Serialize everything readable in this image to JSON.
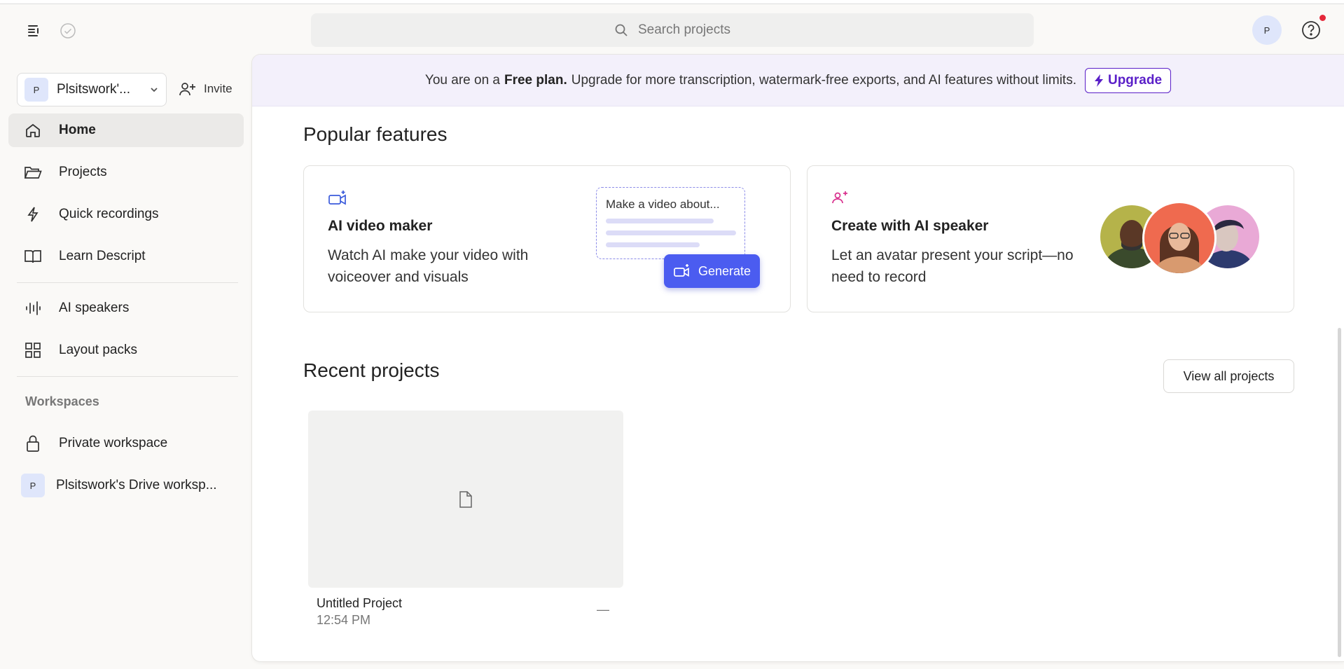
{
  "search": {
    "placeholder": "Search projects"
  },
  "user": {
    "initial": "P"
  },
  "sidebar": {
    "team_name": "Plsitswork'...",
    "team_initial": "P",
    "invite_label": "Invite",
    "items": [
      {
        "label": "Home",
        "icon": "home-icon",
        "active": true
      },
      {
        "label": "Projects",
        "icon": "folder-icon"
      },
      {
        "label": "Quick recordings",
        "icon": "bolt-icon"
      },
      {
        "label": "Learn Descript",
        "icon": "book-icon"
      },
      {
        "label": "AI speakers",
        "icon": "waveform-icon"
      },
      {
        "label": "Layout packs",
        "icon": "grid-icon"
      }
    ],
    "workspaces_title": "Workspaces",
    "workspaces": [
      {
        "label": "Private workspace",
        "icon": "lock-icon"
      },
      {
        "label": "Plsitswork's Drive worksp...",
        "initial": "P"
      }
    ]
  },
  "banner": {
    "prefix": "You are on a",
    "plan": "Free plan.",
    "message": "Upgrade for more transcription, watermark-free exports, and AI features without limits.",
    "upgrade_label": "Upgrade"
  },
  "popular": {
    "title": "Popular features",
    "cards": [
      {
        "title": "AI video maker",
        "description": "Watch AI make your video with voiceover and visuals",
        "prompt": "Make a video about...",
        "button": "Generate"
      },
      {
        "title": "Create with AI speaker",
        "description": "Let an avatar present your script—no need to record"
      }
    ]
  },
  "recent": {
    "title": "Recent projects",
    "view_all_label": "View all projects",
    "projects": [
      {
        "name": "Untitled Project",
        "time": "12:54 PM",
        "meta": "—"
      }
    ]
  },
  "colors": {
    "accent": "#4b5cf0",
    "upgrade": "#5a1fc8",
    "notification": "#e5283a",
    "speaker_icon": "#d9328e"
  }
}
